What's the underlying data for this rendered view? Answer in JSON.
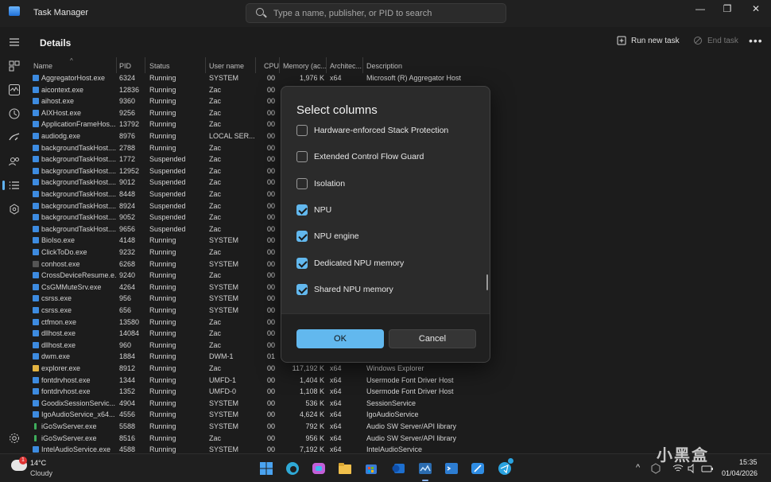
{
  "window": {
    "title": "Task Manager",
    "search_placeholder": "Type a name, publisher, or PID to search",
    "minimize": "—",
    "maximize": "❐",
    "close": "✕"
  },
  "header": {
    "page_title": "Details",
    "run_task": "Run new task",
    "end_task": "End task",
    "more": "•••"
  },
  "table": {
    "columns": [
      "Name",
      "PID",
      "Status",
      "User name",
      "CPU",
      "Memory (ac...",
      "Architec...",
      "Description"
    ],
    "rows": [
      [
        "AggregatorHost.exe",
        "6324",
        "Running",
        "SYSTEM",
        "00",
        "1,976 K",
        "x64",
        "Microsoft (R) Aggregator Host"
      ],
      [
        "aicontext.exe",
        "12836",
        "Running",
        "Zac",
        "00",
        "",
        "",
        ""
      ],
      [
        "aihost.exe",
        "9360",
        "Running",
        "Zac",
        "00",
        "",
        "",
        ""
      ],
      [
        "AIXHost.exe",
        "9256",
        "Running",
        "Zac",
        "00",
        "",
        "",
        ""
      ],
      [
        "ApplicationFrameHos...",
        "13792",
        "Running",
        "Zac",
        "00",
        "",
        "",
        ""
      ],
      [
        "audiodg.exe",
        "8976",
        "Running",
        "LOCAL SER...",
        "00",
        "",
        "",
        ""
      ],
      [
        "backgroundTaskHost....",
        "2788",
        "Running",
        "Zac",
        "00",
        "",
        "",
        ""
      ],
      [
        "backgroundTaskHost....",
        "1772",
        "Suspended",
        "Zac",
        "00",
        "",
        "",
        ""
      ],
      [
        "backgroundTaskHost....",
        "12952",
        "Suspended",
        "Zac",
        "00",
        "",
        "",
        ""
      ],
      [
        "backgroundTaskHost....",
        "9012",
        "Suspended",
        "Zac",
        "00",
        "",
        "",
        ""
      ],
      [
        "backgroundTaskHost....",
        "8448",
        "Suspended",
        "Zac",
        "00",
        "",
        "",
        ""
      ],
      [
        "backgroundTaskHost....",
        "8924",
        "Suspended",
        "Zac",
        "00",
        "",
        "",
        ""
      ],
      [
        "backgroundTaskHost....",
        "9052",
        "Suspended",
        "Zac",
        "00",
        "",
        "",
        ""
      ],
      [
        "backgroundTaskHost....",
        "9656",
        "Suspended",
        "Zac",
        "00",
        "",
        "",
        ""
      ],
      [
        "BioIso.exe",
        "4148",
        "Running",
        "SYSTEM",
        "00",
        "",
        "",
        ""
      ],
      [
        "ClickToDo.exe",
        "9232",
        "Running",
        "Zac",
        "00",
        "",
        "",
        ""
      ],
      [
        "conhost.exe",
        "6268",
        "Running",
        "SYSTEM",
        "00",
        "",
        "",
        ""
      ],
      [
        "CrossDeviceResume.e...",
        "9240",
        "Running",
        "Zac",
        "00",
        "",
        "",
        ""
      ],
      [
        "CsGMMuteSrv.exe",
        "4264",
        "Running",
        "SYSTEM",
        "00",
        "",
        "",
        ""
      ],
      [
        "csrss.exe",
        "956",
        "Running",
        "SYSTEM",
        "00",
        "",
        "",
        ""
      ],
      [
        "csrss.exe",
        "656",
        "Running",
        "SYSTEM",
        "00",
        "",
        "",
        ""
      ],
      [
        "ctfmon.exe",
        "13580",
        "Running",
        "Zac",
        "00",
        "",
        "",
        ""
      ],
      [
        "dllhost.exe",
        "14084",
        "Running",
        "Zac",
        "00",
        "",
        "",
        ""
      ],
      [
        "dllhost.exe",
        "960",
        "Running",
        "Zac",
        "00",
        "",
        "",
        ""
      ],
      [
        "dwm.exe",
        "1884",
        "Running",
        "DWM-1",
        "01",
        "",
        "",
        ""
      ],
      [
        "explorer.exe",
        "8912",
        "Running",
        "Zac",
        "00",
        "117,192 K",
        "x64",
        "Windows Explorer"
      ],
      [
        "fontdrvhost.exe",
        "1344",
        "Running",
        "UMFD-1",
        "00",
        "1,404 K",
        "x64",
        "Usermode Font Driver Host"
      ],
      [
        "fontdrvhost.exe",
        "1352",
        "Running",
        "UMFD-0",
        "00",
        "1,108 K",
        "x64",
        "Usermode Font Driver Host"
      ],
      [
        "GoodixSessionServic...",
        "4904",
        "Running",
        "SYSTEM",
        "00",
        "536 K",
        "x64",
        "SessionService"
      ],
      [
        "IgoAudioService_x64...",
        "4556",
        "Running",
        "SYSTEM",
        "00",
        "4,624 K",
        "x64",
        "IgoAudioService"
      ],
      [
        "iGoSwServer.exe",
        "5588",
        "Running",
        "SYSTEM",
        "00",
        "792 K",
        "x64",
        "Audio SW Server/API library"
      ],
      [
        "iGoSwServer.exe",
        "8516",
        "Running",
        "Zac",
        "00",
        "956 K",
        "x64",
        "Audio SW Server/API library"
      ],
      [
        "IntelAudioService.exe",
        "4588",
        "Running",
        "SYSTEM",
        "00",
        "7,192 K",
        "x64",
        "IntelAudioService"
      ]
    ]
  },
  "dialog": {
    "title": "Select columns",
    "options": [
      {
        "label": "Hardware-enforced Stack Protection",
        "checked": false
      },
      {
        "label": "Extended Control Flow Guard",
        "checked": false
      },
      {
        "label": "Isolation",
        "checked": false
      },
      {
        "label": "NPU",
        "checked": true
      },
      {
        "label": "NPU engine",
        "checked": true
      },
      {
        "label": "Dedicated NPU memory",
        "checked": true
      },
      {
        "label": "Shared NPU memory",
        "checked": true
      }
    ],
    "ok": "OK",
    "cancel": "Cancel"
  },
  "taskbar": {
    "temperature": "14°C",
    "condition": "Cloudy",
    "weather_badge": "1",
    "time": "15:35",
    "date": "01/04/2026",
    "tray_chevron": "^"
  },
  "watermark": "小黑盒"
}
